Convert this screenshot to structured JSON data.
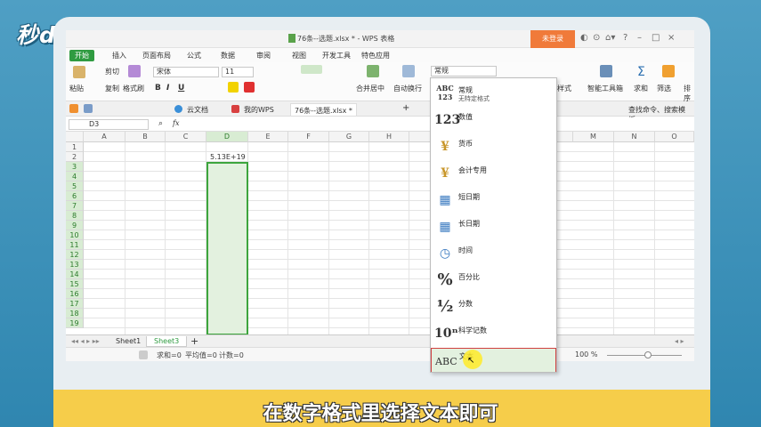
{
  "overlay": {
    "logo": "秒dong视频",
    "caption": "在数字格式里选择文本即可"
  },
  "window": {
    "title": "76条--选题.xlsx * - WPS 表格",
    "login_button": "未登录",
    "controls": [
      "◐",
      "⊙",
      "⌂▾",
      "?",
      "–",
      "□",
      "×"
    ]
  },
  "menu": {
    "items": [
      "开始",
      "插入",
      "页面布局",
      "公式",
      "数据",
      "审阅",
      "视图",
      "开发工具",
      "特色应用"
    ]
  },
  "ribbon": {
    "paste": "粘贴",
    "cut": "剪切",
    "copy": "复制",
    "format_painter": "格式刷",
    "font_name": "宋体",
    "font_size": "11",
    "bold": "B",
    "italic": "I",
    "underline": "U",
    "merge_center": "合并居中",
    "auto_wrap": "自动换行",
    "number_format": "常规",
    "style": "样式",
    "smart_toolbox": "智能工具箱",
    "sum": "求和",
    "filter": "筛选",
    "sort": "排序"
  },
  "tabs": {
    "cloud_docs": "云文档",
    "my_wps": "我的WPS",
    "document": "76条--选题.xlsx *",
    "add": "+",
    "search": "查找命令、搜索模板"
  },
  "formula": {
    "cell_ref": "D3",
    "fx": "fx"
  },
  "grid": {
    "columns": [
      "A",
      "B",
      "C",
      "D",
      "E",
      "F",
      "G",
      "H",
      "M",
      "N",
      "O"
    ],
    "rows": [
      "1",
      "2",
      "3",
      "4",
      "5",
      "6",
      "7",
      "8",
      "9",
      "10",
      "11",
      "12",
      "13",
      "14",
      "15",
      "16",
      "17",
      "18",
      "19"
    ],
    "cell_d2": "5.13E+19"
  },
  "sheets": {
    "tabs": [
      "Sheet1",
      "Sheet3"
    ],
    "add": "+"
  },
  "status": {
    "sum": "求和=0",
    "average": "平均值=0",
    "count": "计数=0",
    "zoom": "100 %"
  },
  "number_format_menu": {
    "items": [
      {
        "icon": "ABC 123",
        "label": "常规",
        "sub": "无特定格式"
      },
      {
        "icon": "123",
        "label": "数值"
      },
      {
        "icon": "¥",
        "label": "货币"
      },
      {
        "icon": "¥",
        "label": "会计专用"
      },
      {
        "icon": "▦",
        "label": "短日期"
      },
      {
        "icon": "▦",
        "label": "长日期"
      },
      {
        "icon": "◷",
        "label": "时间"
      },
      {
        "icon": "%",
        "label": "百分比"
      },
      {
        "icon": "½",
        "label": "分数"
      },
      {
        "icon": "10ⁿ",
        "label": "科学记数"
      },
      {
        "icon": "ABC",
        "label": "文本"
      }
    ]
  },
  "colors": {
    "accent_green": "#2f9b41",
    "login_orange": "#f07a3a",
    "caption_yellow": "#f6cd4a",
    "highlight_red": "#d04040"
  }
}
